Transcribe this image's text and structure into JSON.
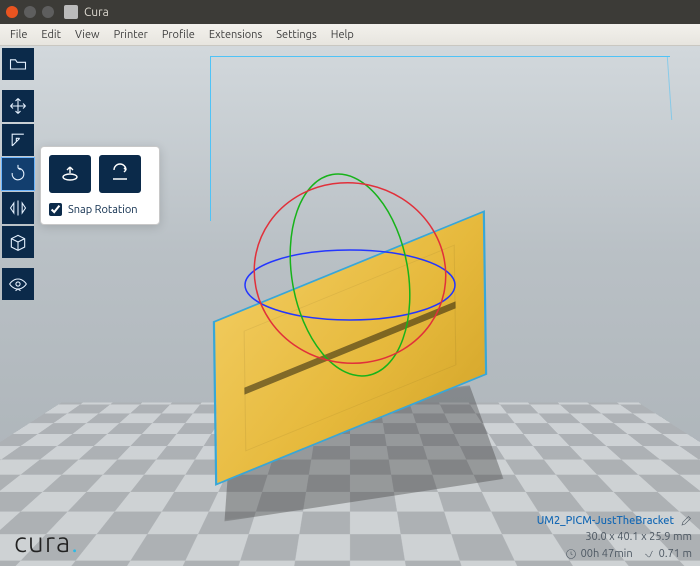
{
  "window": {
    "title": "Cura"
  },
  "menu": {
    "items": [
      "File",
      "Edit",
      "View",
      "Printer",
      "Profile",
      "Extensions",
      "Settings",
      "Help"
    ]
  },
  "toolbar": {
    "tools": [
      {
        "name": "open-file",
        "active": false
      },
      {
        "name": "move",
        "active": false
      },
      {
        "name": "scale",
        "active": false
      },
      {
        "name": "rotate",
        "active": true
      },
      {
        "name": "mirror",
        "active": false
      },
      {
        "name": "per-model",
        "active": false
      },
      {
        "name": "view-mode",
        "active": false
      }
    ]
  },
  "rotate_panel": {
    "reset_tooltip": "Reset",
    "layflat_tooltip": "Lay flat",
    "snap_label": "Snap Rotation",
    "snap_checked": true
  },
  "brand": {
    "text": "cura",
    "dot": "."
  },
  "info": {
    "filename": "UM2_PICM-JustTheBracket",
    "edit_icon": "pencil-icon",
    "dimensions": "30.0 x 40.1 x 25.9 mm",
    "time": "00h 47min",
    "length": "0.71 m"
  }
}
